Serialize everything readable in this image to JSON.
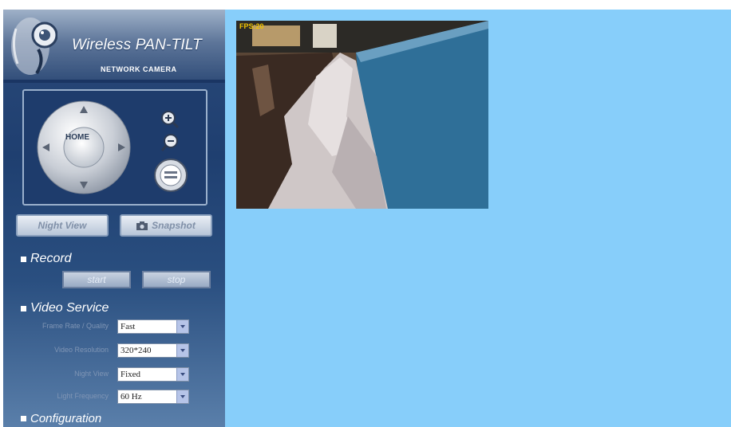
{
  "brand": {
    "title": "Wireless PAN-TILT",
    "subtitle": "NETWORK CAMERA"
  },
  "ptz": {
    "home_label": "HOME"
  },
  "buttons": {
    "night_view": "Night View",
    "snapshot": "Snapshot"
  },
  "record": {
    "title": "Record",
    "start": "start",
    "stop": "stop"
  },
  "video_service": {
    "title": "Video Service",
    "fields": [
      {
        "label": "Frame Rate / Quality",
        "value": "Fast"
      },
      {
        "label": "Video Resolution",
        "value": "320*240"
      },
      {
        "label": "Night View",
        "value": "Fixed"
      },
      {
        "label": "Light Frequency",
        "value": "60 Hz"
      }
    ]
  },
  "configuration": {
    "title": "Configuration"
  },
  "video": {
    "overlay": "FPS:20"
  },
  "colors": {
    "main_background": "#87cefa",
    "sidebar_background": "#1f3f70"
  }
}
